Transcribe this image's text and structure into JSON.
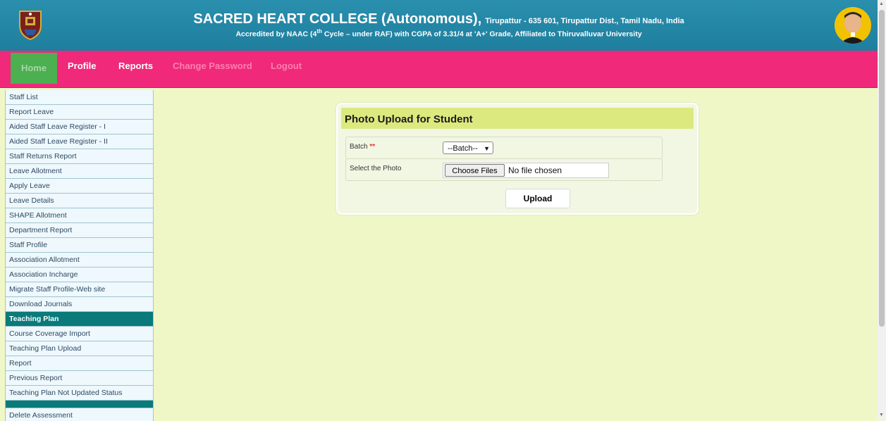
{
  "header": {
    "title_main": "SACRED HEART COLLEGE (Autonomous),",
    "title_rest": "Tirupattur - 635 601, Tirupattur Dist., Tamil Nadu, India",
    "subtitle_pre": "Accredited by NAAC (4",
    "subtitle_sup": "th",
    "subtitle_post": " Cycle – under RAF) with CGPA of 3.31/4 at 'A+' Grade, Affiliated to Thiruvalluvar University"
  },
  "nav": {
    "items": [
      "Home",
      "Profile",
      "Reports",
      "Change Password",
      "Logout"
    ]
  },
  "sidebar": {
    "items": [
      "Staff List",
      "Report Leave",
      "Aided Staff Leave Register - I",
      "Aided Staff Leave Register - II",
      "Staff Returns Report",
      "Leave Allotment",
      "Apply Leave",
      "Leave Details",
      "SHAPE Allotment",
      "Department Report",
      "Staff Profile",
      "Association Allotment",
      "Association Incharge",
      "Migrate Staff Profile-Web site",
      "Download Journals"
    ],
    "section_heading": "Teaching Plan",
    "section_items": [
      "Course Coverage Import",
      "Teaching Plan Upload",
      "Report",
      "Previous Report",
      "Teaching Plan Not Updated Status"
    ],
    "after_items": [
      "Delete Assessment"
    ]
  },
  "form": {
    "title": "Photo Upload for Student",
    "batch_label": "Batch",
    "required_mark": "**",
    "batch_selected": "--Batch--",
    "photo_label": "Select the Photo",
    "choose_files": "Choose Files",
    "no_file": "No file chosen",
    "upload": "Upload"
  },
  "colors": {
    "header_bg": "#1f7e9e",
    "nav_bg": "#f0297a",
    "nav_active": "#4caf50",
    "sidebar_heading": "#0a7a7a",
    "page_bg": "#f0f7c7",
    "card_title_bg": "#dce97f"
  }
}
